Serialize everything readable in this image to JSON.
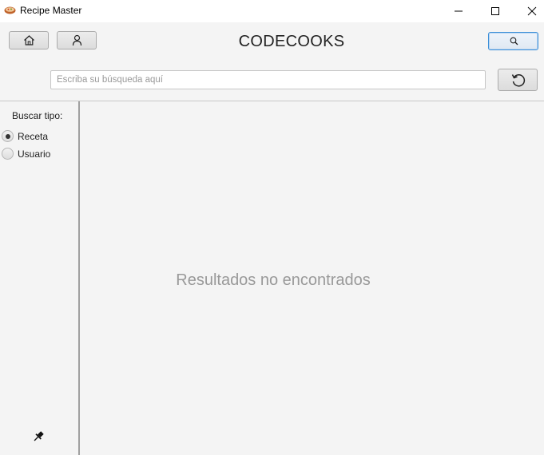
{
  "window": {
    "title": "Recipe Master",
    "icons": {
      "app": "recipe-bowl-icon",
      "minimize": "minimize-icon",
      "maximize": "maximize-icon",
      "close": "close-icon"
    }
  },
  "header": {
    "brand": "CODECOOKS",
    "home_icon": "home-icon",
    "user_icon": "user-icon",
    "search_icon": "search-icon",
    "refresh_icon": "refresh-icon",
    "search": {
      "value": "",
      "placeholder": "Escriba su búsqueda aquí"
    }
  },
  "sidebar": {
    "label": "Buscar tipo:",
    "options": [
      {
        "label": "Receta",
        "selected": true
      },
      {
        "label": "Usuario",
        "selected": false
      }
    ],
    "pin_icon": "pin-icon"
  },
  "main": {
    "empty_message": "Resultados no encontrados"
  },
  "colors": {
    "accent": "#3c8fd8",
    "background": "#f4f4f4",
    "muted_text": "#999999"
  }
}
